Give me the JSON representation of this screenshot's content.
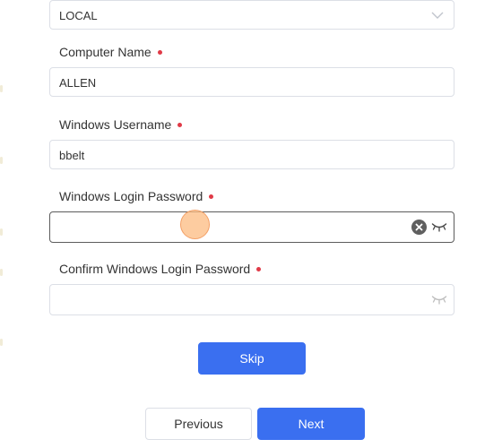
{
  "form": {
    "account_type": {
      "value": "LOCAL"
    },
    "computer_name": {
      "label": "Computer Name",
      "value": "ALLEN",
      "required": true
    },
    "windows_username": {
      "label": "Windows Username",
      "value": "bbelt",
      "required": true
    },
    "windows_login_password": {
      "label": "Windows Login Password",
      "value": "",
      "required": true,
      "icons": [
        "clear-icon",
        "eye-closed-icon"
      ]
    },
    "confirm_windows_login_password": {
      "label": "Confirm Windows Login Password",
      "value": "",
      "required": true,
      "icons": [
        "eye-closed-icon"
      ]
    }
  },
  "buttons": {
    "skip_label": "Skip",
    "previous_label": "Previous",
    "next_label": "Next"
  },
  "colors": {
    "primary": "#3a6ff0",
    "required_marker": "#e03a47",
    "border": "#dcdfe6",
    "active_border": "#5c5c5c"
  }
}
